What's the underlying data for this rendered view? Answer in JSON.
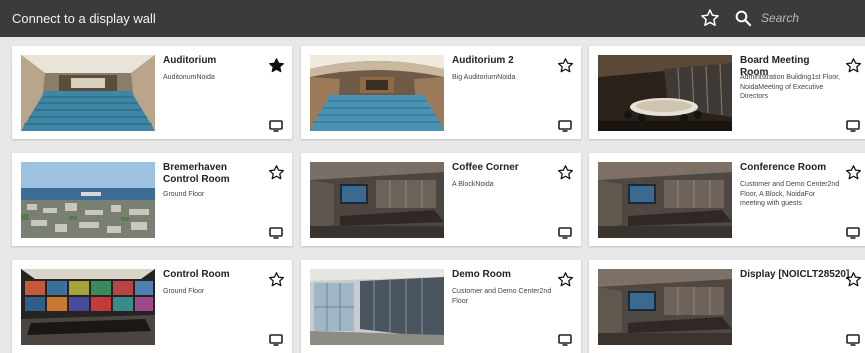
{
  "header": {
    "title": "Connect to a display wall",
    "search_placeholder": "Search"
  },
  "rooms": [
    {
      "name": "Auditorium",
      "description": "AuditoriumNoida",
      "favorite": true
    },
    {
      "name": "Auditorium 2",
      "description": "Big AuditoriumNoida",
      "favorite": false
    },
    {
      "name": "Board Meeting Room",
      "description": "Administration Building1st Floor, NoidaMeeting of Executive Directors",
      "favorite": false
    },
    {
      "name": "Bremerhaven Control Room",
      "description": "Ground Floor",
      "favorite": false
    },
    {
      "name": "Coffee Corner",
      "description": "A BlockNoida",
      "favorite": false
    },
    {
      "name": "Conference Room",
      "description": "Customer and Demo Center2nd Floor, A Block, NoidaFor meeting with guests",
      "favorite": false
    },
    {
      "name": "Control Room",
      "description": "Ground Floor",
      "favorite": false
    },
    {
      "name": "Demo Room",
      "description": "Customer and Demo Center2nd Floor",
      "favorite": false
    },
    {
      "name": "Display [NOICLT28520]",
      "description": "",
      "favorite": false
    }
  ],
  "icons": {
    "header_favorites": "star-outline-icon",
    "search": "search-icon",
    "favorite_on": "star-filled-icon",
    "favorite_off": "star-outline-icon",
    "display": "monitor-icon"
  },
  "colors": {
    "header_bg": "#3b3b3b",
    "page_bg": "#e8e8e8",
    "card_bg": "#ffffff"
  }
}
